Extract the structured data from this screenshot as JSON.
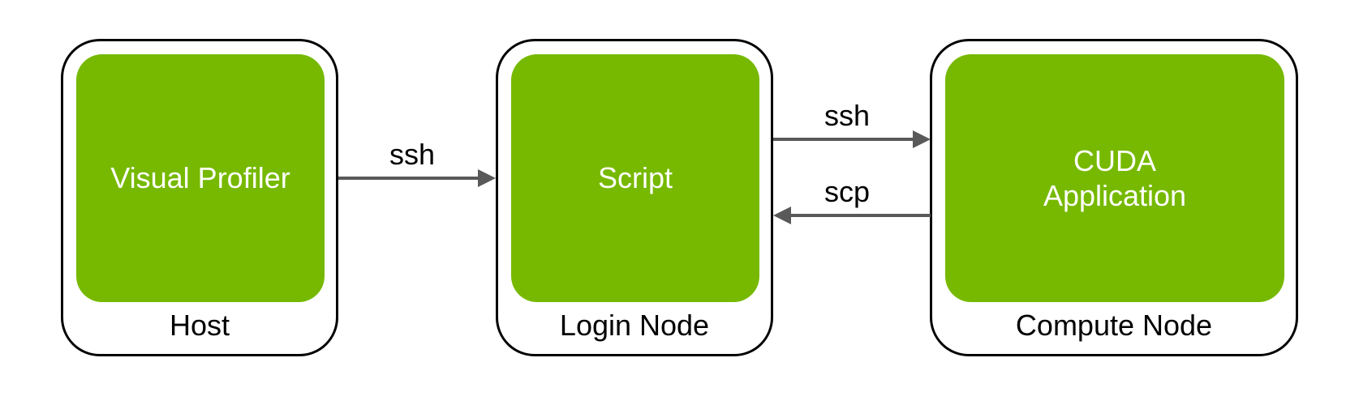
{
  "nodes": {
    "host": {
      "inner_label": "Visual Profiler",
      "outer_label": "Host"
    },
    "login": {
      "inner_label": "Script",
      "outer_label": "Login Node"
    },
    "compute": {
      "inner_label": "CUDA Application",
      "outer_label": "Compute Node"
    }
  },
  "arrows": {
    "host_to_login": "ssh",
    "login_to_compute": "ssh",
    "compute_to_login": "scp"
  },
  "colors": {
    "inner_fill": "#76b900",
    "arrow": "#595959"
  }
}
